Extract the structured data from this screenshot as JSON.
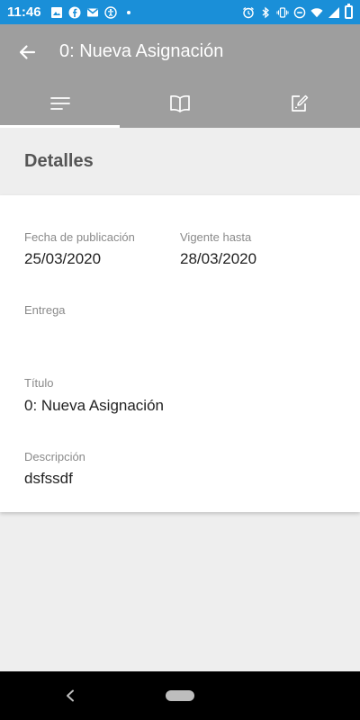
{
  "status_bar": {
    "time": "11:46",
    "color": "#1a8fd8",
    "left_icons": [
      "image-icon",
      "facebook-icon",
      "gmail-icon",
      "accessibility-icon",
      "dot-icon"
    ],
    "right_icons": [
      "alarm-icon",
      "bluetooth-icon",
      "vibrate-icon",
      "dnd-icon",
      "wifi-icon",
      "signal-icon",
      "battery-icon"
    ]
  },
  "app_bar": {
    "title": "0: Nueva Asignación",
    "color": "#9e9e9e",
    "back_icon": "arrow-left-icon"
  },
  "tabs": [
    {
      "icon": "details-lines-icon",
      "active": true
    },
    {
      "icon": "book-icon",
      "active": false
    },
    {
      "icon": "edit-note-icon",
      "active": false
    }
  ],
  "section": {
    "heading": "Detalles"
  },
  "details": {
    "publish_date_label": "Fecha de publicación",
    "publish_date_value": "25/03/2020",
    "valid_until_label": "Vigente hasta",
    "valid_until_value": "28/03/2020",
    "delivery_label": "Entrega",
    "title_label": "Título",
    "title_value": "0: Nueva Asignación",
    "description_label": "Descripción",
    "description_value": "dsfssdf"
  },
  "nav_bar": {
    "back_icon": "nav-back-icon",
    "home_icon": "home-pill-icon"
  }
}
